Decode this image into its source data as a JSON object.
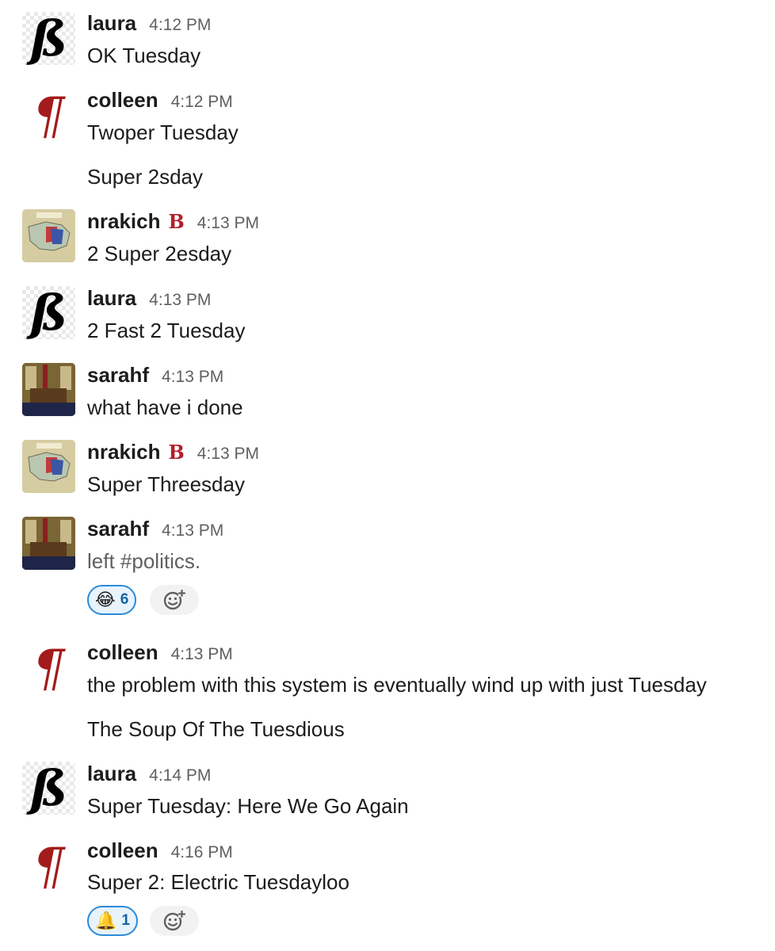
{
  "messages": [
    {
      "user": "laura",
      "time": "4:12 PM",
      "lines": [
        "OK Tuesday"
      ]
    },
    {
      "user": "colleen",
      "time": "4:12 PM",
      "lines": [
        "Twoper Tuesday",
        "Super 2sday"
      ]
    },
    {
      "user": "nrakich",
      "badge": "B",
      "time": "4:13 PM",
      "lines": [
        "2 Super 2esday"
      ]
    },
    {
      "user": "laura",
      "time": "4:13 PM",
      "lines": [
        "2 Fast 2 Tuesday"
      ]
    },
    {
      "user": "sarahf",
      "time": "4:13 PM",
      "lines": [
        "what have i done"
      ]
    },
    {
      "user": "nrakich",
      "badge": "B",
      "time": "4:13 PM",
      "lines": [
        "Super Threesday"
      ]
    },
    {
      "user": "sarahf",
      "time": "4:13 PM",
      "lines": [
        "left #politics."
      ],
      "reaction": {
        "emoji": "😂",
        "count": "6"
      }
    },
    {
      "user": "colleen",
      "time": "4:13 PM",
      "lines": [
        "the problem with this system is eventually wind up with just Tuesday",
        "The Soup Of The Tuesdious"
      ]
    },
    {
      "user": "laura",
      "time": "4:14 PM",
      "lines": [
        "Super Tuesday: Here We Go Again"
      ]
    },
    {
      "user": "colleen",
      "time": "4:16 PM",
      "lines": [
        "Super 2: Electric Tuesdayloo"
      ],
      "reaction": {
        "emoji": "🔔",
        "count": "1"
      }
    }
  ],
  "avatars": {
    "laura": {
      "glyph": "ß",
      "icon": "eszett-avatar-icon"
    },
    "colleen": {
      "glyph": "¶",
      "icon": "pilcrow-avatar-icon"
    },
    "nrakich": {
      "icon": "map-avatar-icon"
    },
    "sarahf": {
      "icon": "oval-office-avatar-icon"
    }
  },
  "colors": {
    "badge_red": "#b3202a",
    "reaction_border": "#2c8bd8",
    "reaction_count": "#1264a3"
  }
}
